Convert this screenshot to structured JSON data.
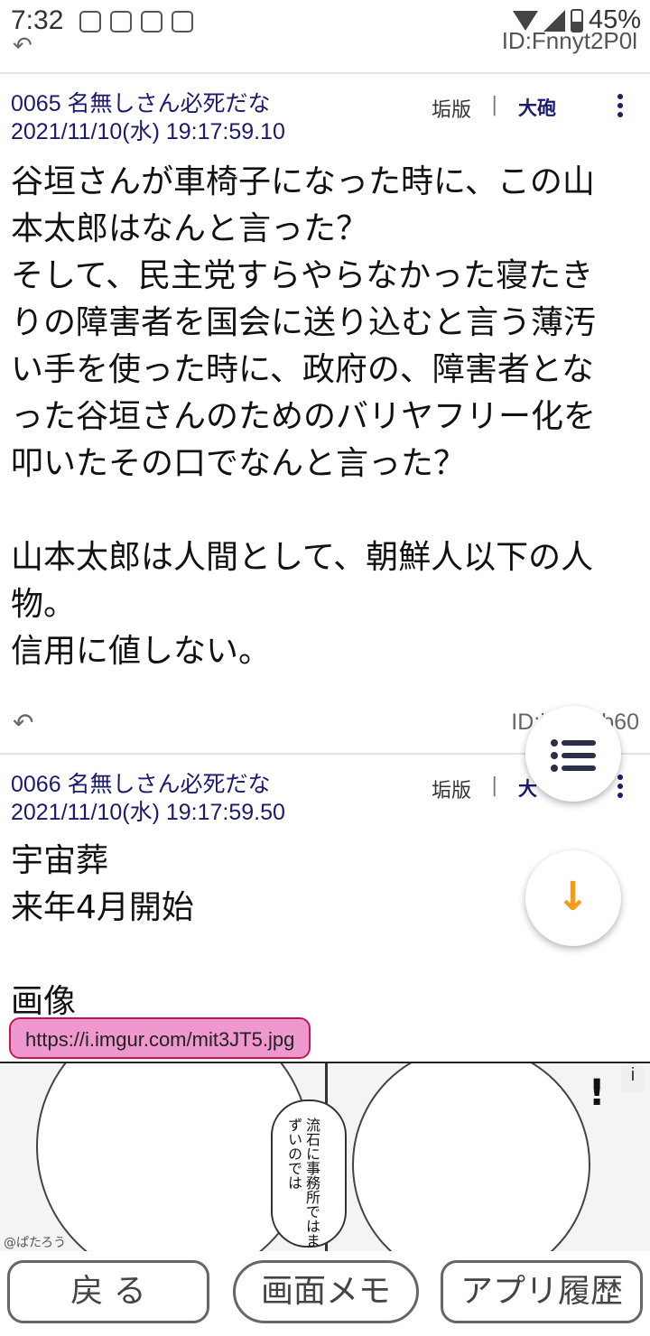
{
  "status": {
    "time": "7:32",
    "battery": "45%",
    "icons": [
      "notification-icon",
      "phone-icon",
      "phone-icon",
      "download-icon",
      "wifi-icon",
      "signal-icon",
      "battery-icon"
    ]
  },
  "prev_post": {
    "reply_glyph": "↶",
    "id": "ID:Fnnyt2P0l"
  },
  "posts": [
    {
      "header": "0065 名無しさん必死だな 2021/11/10(水) 19:17:59.10",
      "board": "垢版",
      "sep": "|",
      "category": "大砲",
      "body": "谷垣さんが車椅子になった時に、この山本太郎はなんと言った？\nそして、民主党すらやらなかった寝たきりの障害者を国会に送り込むと言う薄汚い手を使った時に、政府の、障害者となった谷垣さんのためのバリヤフリー化を叩いたその口でなんと言った？\n\n山本太郎は人間として、朝鮮人以下の人物。\n信用に値しない。",
      "id": "ID:i     b60"
    },
    {
      "header": "0066 名無しさん必死だな 2021/11/10(水) 19:17:59.50",
      "board": "垢版",
      "sep": "|",
      "category": "大",
      "body": "宇宙葬\n来年4月開始\n\n画像",
      "link": "https://i.imgur.com/mit3JT5.jpg"
    }
  ],
  "image": {
    "bubble_text": "流石に事務所ではまずいのでは",
    "exclaim": "!",
    "badge": "i",
    "watermark": "@ぱたろう"
  },
  "fabs": {
    "list_icon": "list-icon",
    "down_glyph": "↓"
  },
  "bottom": {
    "back": "戻 る",
    "memo": "画面メモ",
    "history": "アプリ履歴"
  },
  "colors": {
    "header": "#1a1a6e",
    "link_bg": "#ef97cf",
    "link_border": "#c2184f",
    "fab_arrow": "#f39b1e"
  }
}
